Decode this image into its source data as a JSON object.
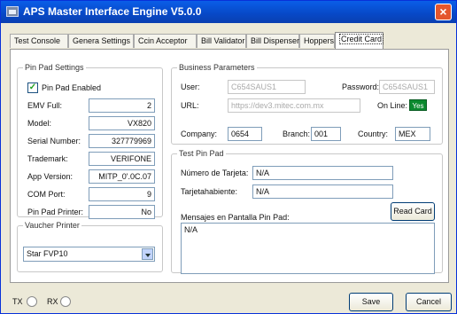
{
  "window": {
    "title": "APS Master Interface Engine V5.0.0"
  },
  "tabs": [
    "Test Console",
    "Genera Settings",
    "Ccin Acceptor",
    "Bill Validator",
    "Bill Dispenser",
    "Hoppers",
    "Credit Card"
  ],
  "pin_pad": {
    "legend": "Pin Pad Settings",
    "enabled_label": "Pin Pad Enabled",
    "enabled_checked": true,
    "fields": [
      {
        "label": "EMV Full:",
        "value": "2"
      },
      {
        "label": "Model:",
        "value": "VX820"
      },
      {
        "label": "Serial Number:",
        "value": "327779969"
      },
      {
        "label": "Trademark:",
        "value": "VERIFONE"
      },
      {
        "label": "App Version:",
        "value": "MITP_0'.0C.07"
      },
      {
        "label": "COM Port:",
        "value": "9"
      },
      {
        "label": "Pin Pad Printer:",
        "value": "No"
      }
    ]
  },
  "voucher": {
    "legend": "Vaucher Printer",
    "selected": "Star FVP10"
  },
  "business": {
    "legend": "Business Parameters",
    "user_label": "User:",
    "user_value": "C654SAUS1",
    "password_label": "Password:",
    "password_value": "C654SAUS1",
    "url_label": "URL:",
    "url_value": "https://dev3.mitec.com.mx",
    "online_label": "On Line:",
    "online_value": "Yes",
    "company_label": "Company:",
    "company_value": "0654",
    "branch_label": "Branch:",
    "branch_value": "001",
    "country_label": "Country:",
    "country_value": "MEX"
  },
  "test_pin_pad": {
    "legend": "Test Pin Pad",
    "card_label": "Número de Tarjeta:",
    "card_value": "N/A",
    "holder_label": "Tarjetahabiente:",
    "holder_value": "N/A",
    "read_card": "Read Card",
    "message_label": "Mensajes en Pantalla Pin Pad:",
    "message_value": "N/A"
  },
  "status": {
    "tx": "TX",
    "rx": "RX"
  },
  "actions": {
    "save": "Save",
    "cancel": "Cancel"
  }
}
